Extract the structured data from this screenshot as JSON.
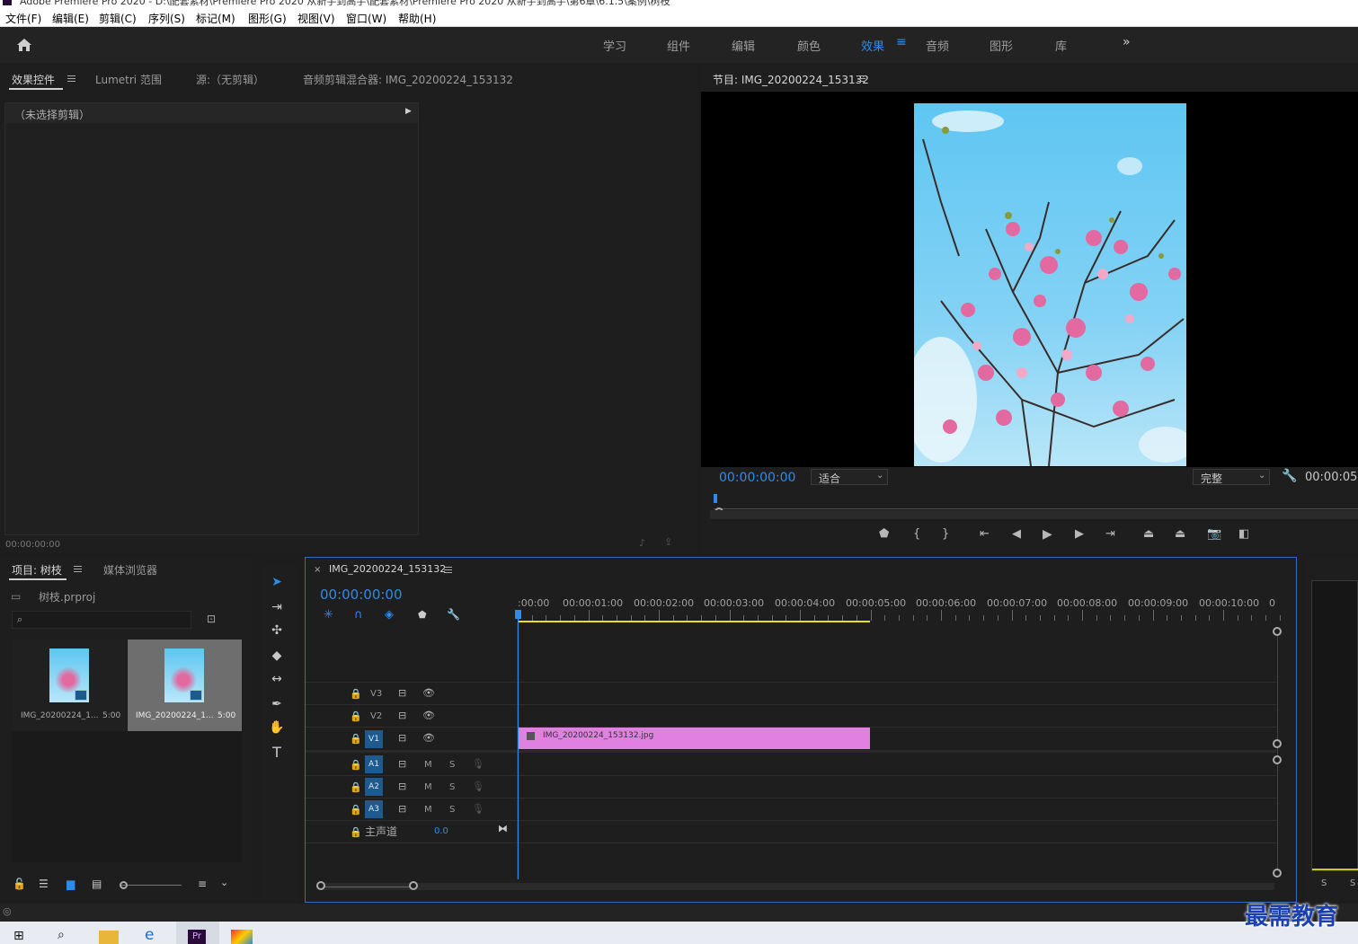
{
  "window": {
    "title": "Adobe Premiere Pro 2020 - D:\\配套素材\\Premiere Pro 2020 从新手到高手\\配套素材\\Premiere Pro 2020 从新手到高手\\第6章\\6.1.5\\案例\\树枝"
  },
  "menu": [
    "文件(F)",
    "编辑(E)",
    "剪辑(C)",
    "序列(S)",
    "标记(M)",
    "图形(G)",
    "视图(V)",
    "窗口(W)",
    "帮助(H)"
  ],
  "workspaces": [
    "学习",
    "组件",
    "编辑",
    "颜色",
    "效果",
    "音频",
    "图形",
    "库"
  ],
  "active_workspace": "效果",
  "source_panel": {
    "tabs": [
      "效果控件",
      "Lumetri 范围",
      "源:（无剪辑）",
      "音频剪辑混合器: IMG_20200224_153132"
    ],
    "no_clip": "（未选择剪辑）",
    "timecode": "00:00:00:00"
  },
  "program": {
    "title": "节目: IMG_20200224_153132",
    "timecode": "00:00:00:00",
    "fit": "适合",
    "quality": "完整",
    "duration": "00:00:05:"
  },
  "project": {
    "tabs": [
      "项目: 树枝",
      "媒体浏览器"
    ],
    "file": "树枝.prproj",
    "search_placeholder": "",
    "items": [
      {
        "name": "IMG_20200224_1...",
        "duration": "5:00"
      },
      {
        "name": "IMG_20200224_1...",
        "duration": "5:00"
      }
    ]
  },
  "timeline": {
    "sequence": "IMG_20200224_153132",
    "timecode": "00:00:00:00",
    "ruler": [
      ":00:00",
      "00:00:01:00",
      "00:00:02:00",
      "00:00:03:00",
      "00:00:04:00",
      "00:00:05:00",
      "00:00:06:00",
      "00:00:07:00",
      "00:00:08:00",
      "00:00:09:00",
      "00:00:10:00",
      "0"
    ],
    "video_tracks": [
      "V3",
      "V2",
      "V1"
    ],
    "audio_tracks": [
      "A1",
      "A2",
      "A3"
    ],
    "track_m": "M",
    "track_s": "S",
    "master_label": "主声道",
    "master_value": "0.0",
    "clip_name": "IMG_20200224_153132.jpg"
  },
  "meter_labels": [
    "S",
    "S"
  ],
  "watermark": "最需教育",
  "colors": {
    "accent": "#2d8ceb",
    "clip": "#e080e0",
    "track_button": "#1e5a8e",
    "timeline_border": "#2d6fb8"
  }
}
